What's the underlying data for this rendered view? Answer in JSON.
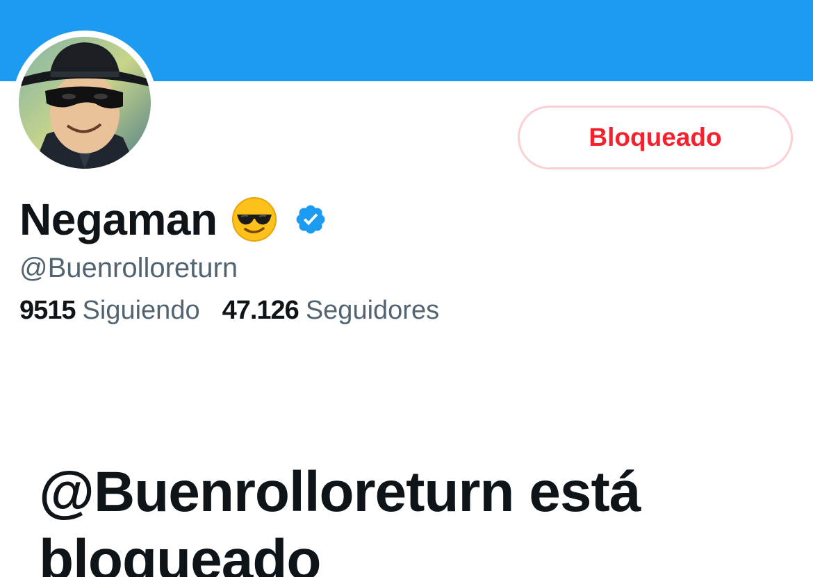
{
  "profile": {
    "display_name": "Negaman",
    "name_emoji": "😎",
    "verified": true,
    "handle": "@Buenrolloreturn",
    "following_count": "9515",
    "following_label": "Siguiendo",
    "followers_count": "47.126",
    "followers_label": "Seguidores"
  },
  "actions": {
    "blocked_label": "Bloqueado"
  },
  "blocked_notice": {
    "title": "@Buenrolloreturn está bloqueado"
  },
  "colors": {
    "banner": "#1d9bf0",
    "blocked_text": "#f4212e",
    "blocked_border": "#fccfd4",
    "verified": "#1d9bf0",
    "primary_text": "#0f1419",
    "secondary_text": "#536471"
  },
  "icons": {
    "verified": "verified-badge-icon",
    "emoji": "sunglasses-emoji-icon"
  }
}
